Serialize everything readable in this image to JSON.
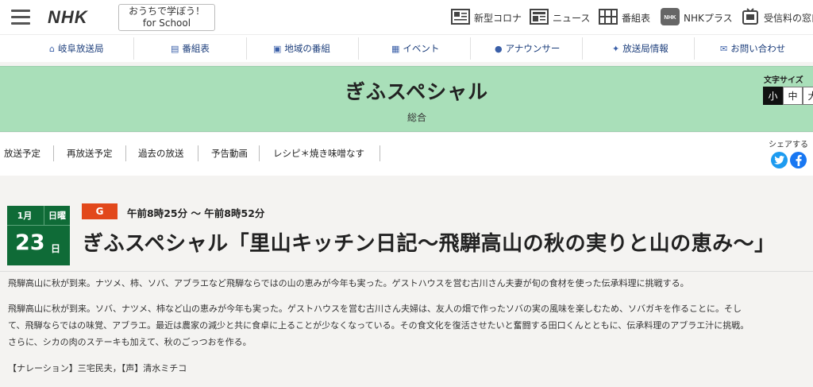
{
  "header": {
    "logo": "NHK",
    "school_line1": "おうちで学ぼう！",
    "school_line2": "for School",
    "tools": [
      {
        "icon": "virus-info-icon",
        "label": "新型コロナ"
      },
      {
        "icon": "news-icon",
        "label": "ニュース"
      },
      {
        "icon": "program-guide-icon",
        "label": "番組表"
      },
      {
        "icon": "nhk-plus-icon",
        "label": "NHKプラス"
      },
      {
        "icon": "license-fee-icon",
        "label": "受信料の窓口"
      }
    ]
  },
  "nav": {
    "items": [
      {
        "icon": "home-icon",
        "glyph": "⌂",
        "label": "岐阜放送局"
      },
      {
        "icon": "tv-guide-icon",
        "glyph": "▤",
        "label": "番組表"
      },
      {
        "icon": "local-program-icon",
        "glyph": "▣",
        "label": "地域の番組"
      },
      {
        "icon": "calendar-icon",
        "glyph": "▦",
        "label": "イベント"
      },
      {
        "icon": "people-icon",
        "glyph": "●",
        "label": "アナウンサー"
      },
      {
        "icon": "antenna-icon",
        "glyph": "✦",
        "label": "放送局情報"
      },
      {
        "icon": "mail-icon",
        "glyph": "✉",
        "label": "お問い合わせ"
      }
    ]
  },
  "hero": {
    "title": "ぎふスペシャル",
    "channel": "総合",
    "font_size_label": "文字サイズ",
    "font_sizes": [
      "小",
      "中",
      "大"
    ],
    "font_size_selected": "小",
    "bg_color": "#a9dfb9"
  },
  "tabs": {
    "items": [
      "放送予定",
      "再放送予定",
      "過去の放送",
      "予告動画",
      "レシピ＊焼き味噌なす"
    ],
    "share_label": "シェアする"
  },
  "episode": {
    "month": "1月",
    "day_of_week": "日曜",
    "day": "23",
    "day_suffix": "日",
    "channel_badge": "G",
    "airtime": "午前8時25分 〜 午前8時52分",
    "title": "ぎふスペシャル「里山キッチン日記〜飛騨高山の秋の実りと山の恵み〜」",
    "summary": "飛騨高山に秋が到来。ナツメ、柿、ソバ、アブラエなど飛騨ならではの山の恵みが今年も実った。ゲストハウスを営む古川さん夫妻が旬の食材を使った伝承料理に挑戦する。",
    "body_lines": [
      "飛騨高山に秋が到来。ソバ、ナツメ、柿など山の恵みが今年も実った。ゲストハウスを営む古川さん夫婦は、友人の畑で作ったソバの実の風味を楽しむため、ソバガキを作ることに。そし",
      "て、飛騨ならではの味覚、アブラエ。最近は農家の減少と共に食卓に上ることが少なくなっている。その食文化を復活させたいと奮闘する田口くんとともに、伝承料理のアブラエ汁に挑戦。",
      "さらに、シカの肉のステーキも加えて、秋のごっつおを作る。"
    ],
    "credits": "【ナレーション】三宅民夫，【声】清水ミチコ"
  },
  "colors": {
    "accent_green": "#0f6b37",
    "channel_red": "#e2481b",
    "twitter_blue": "#1d9bf0",
    "facebook_blue": "#1877f2"
  }
}
